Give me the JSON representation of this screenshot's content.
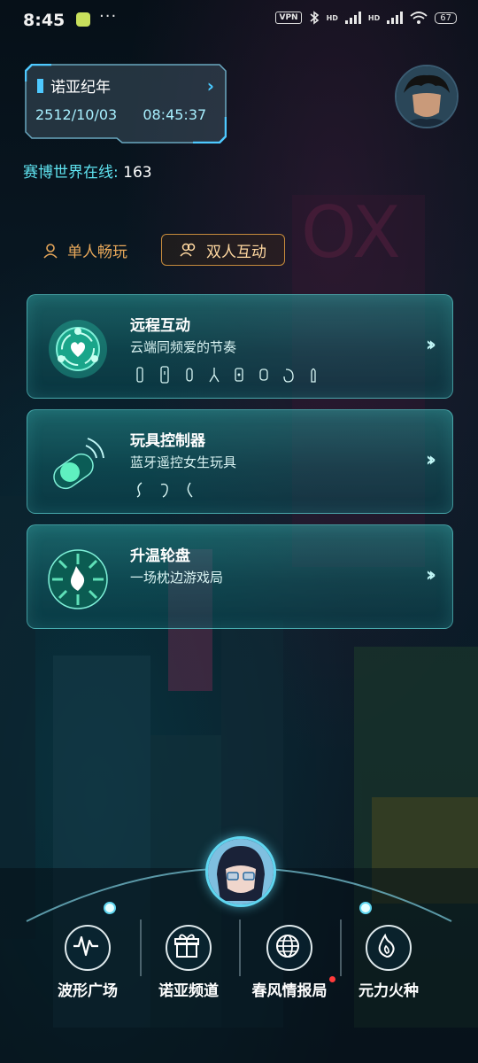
{
  "status_bar": {
    "time": "8:45",
    "dots": "···",
    "vpn": "VPN",
    "hd1": "HD",
    "hd2": "HD",
    "battery": "67"
  },
  "date_panel": {
    "title": "诺亚纪年",
    "date": "2512/10/03",
    "time": "08:45:37"
  },
  "online": {
    "label": "赛博世界在线: ",
    "count": "163"
  },
  "tabs": {
    "single": "单人畅玩",
    "dual": "双人互动",
    "active": "dual"
  },
  "cards": [
    {
      "title": "远程互动",
      "subtitle": "云端同频爱的节奏",
      "icon": "heart-orbit-icon",
      "device_count": 8
    },
    {
      "title": "玩具控制器",
      "subtitle": "蓝牙遥控女生玩具",
      "icon": "bluetooth-toggle-icon",
      "device_count": 3
    },
    {
      "title": "升温轮盘",
      "subtitle": "一场枕边游戏局",
      "icon": "flame-wheel-icon",
      "device_count": 0
    }
  ],
  "bottom_nav": [
    {
      "label": "波形广场",
      "icon": "wave-icon"
    },
    {
      "label": "诺亚频道",
      "icon": "gift-icon"
    },
    {
      "label": "春风情报局",
      "icon": "globe-icon",
      "badge": true
    },
    {
      "label": "元力火种",
      "icon": "fire-icon"
    }
  ],
  "colors": {
    "accent_cyan": "#5fe3f0",
    "accent_orange": "#e8a85a",
    "card_border": "#6ee6e6"
  }
}
